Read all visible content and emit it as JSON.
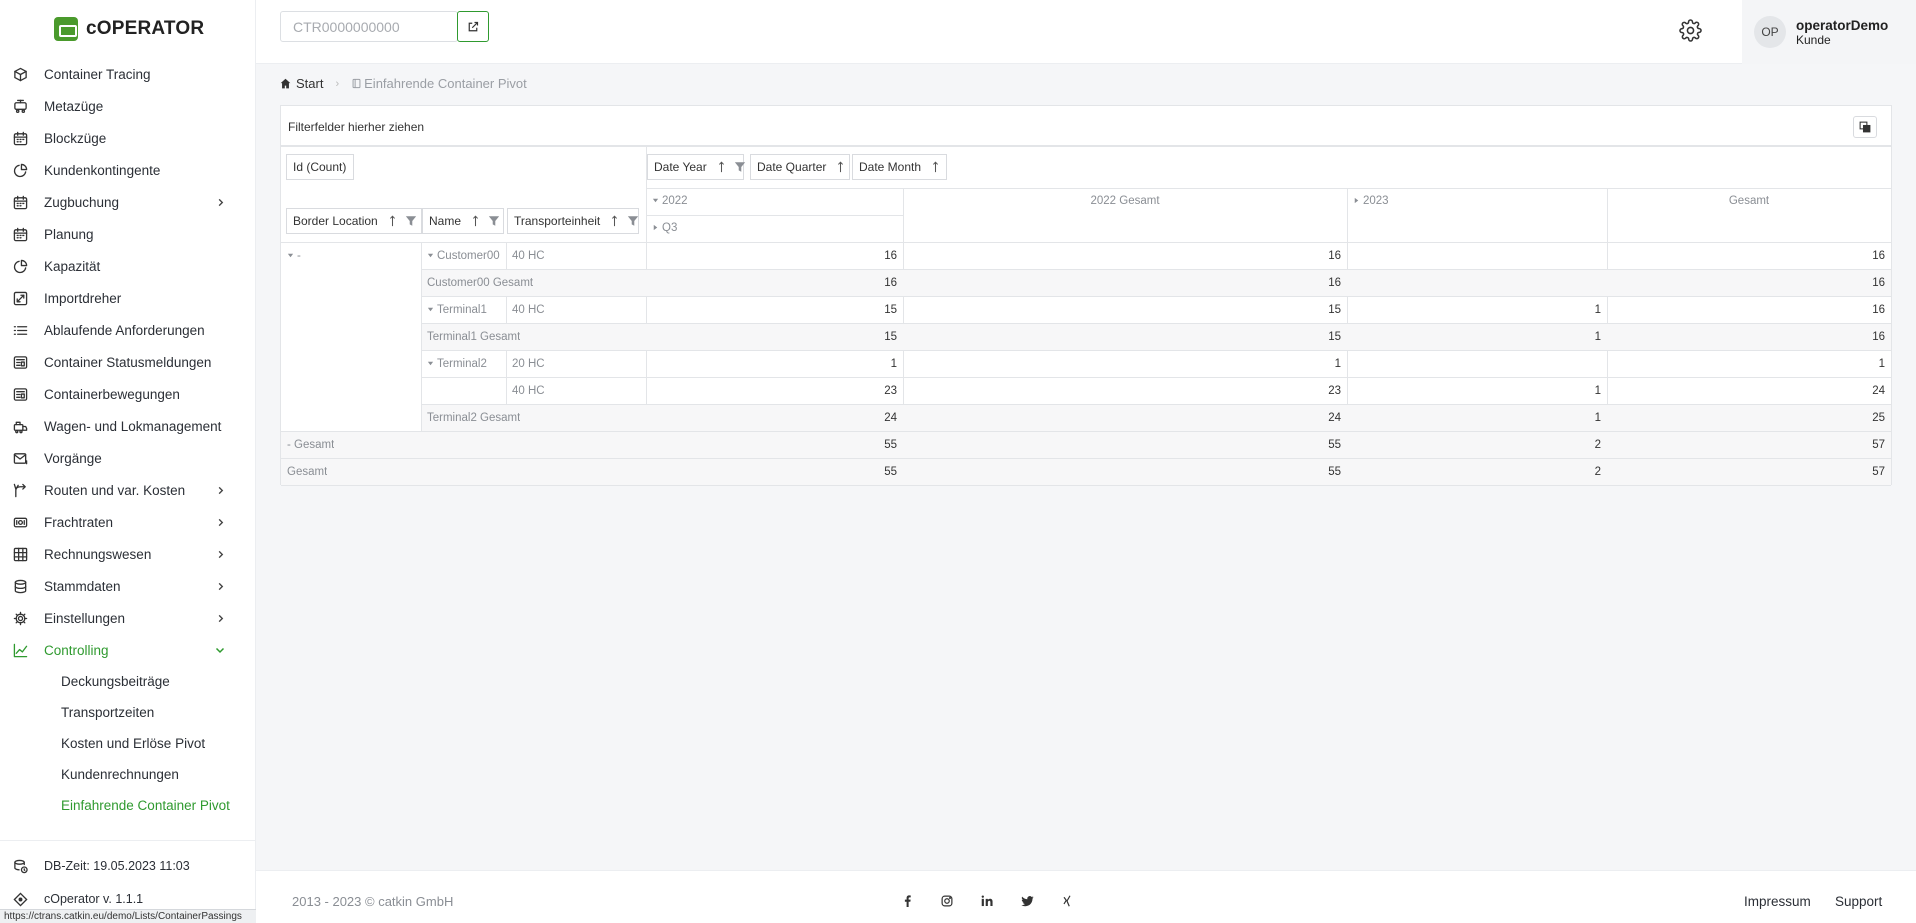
{
  "app": {
    "brand": "cOPERATOR"
  },
  "sidebar": {
    "items": [
      {
        "label": "Container Tracing",
        "icon": "cube-icon"
      },
      {
        "label": "Metazüge",
        "icon": "train-icon"
      },
      {
        "label": "Blockzüge",
        "icon": "calendar-icon"
      },
      {
        "label": "Kundenkontingente",
        "icon": "pie-icon"
      },
      {
        "label": "Zugbuchung",
        "icon": "calendar-icon",
        "expandable": true
      },
      {
        "label": "Planung",
        "icon": "calendar-icon"
      },
      {
        "label": "Kapazität",
        "icon": "pie-icon"
      },
      {
        "label": "Importdreher",
        "icon": "swap-icon"
      },
      {
        "label": "Ablaufende Anforderungen",
        "icon": "list-icon"
      },
      {
        "label": "Container Statusmeldungen",
        "icon": "news-icon"
      },
      {
        "label": "Containerbewegungen",
        "icon": "news-icon"
      },
      {
        "label": "Wagen- und Lokmanagement",
        "icon": "locomotive-icon"
      },
      {
        "label": "Vorgänge",
        "icon": "mail-icon"
      },
      {
        "label": "Routen und var. Kosten",
        "icon": "route-icon",
        "expandable": true
      },
      {
        "label": "Frachtraten",
        "icon": "money-icon",
        "expandable": true
      },
      {
        "label": "Rechnungswesen",
        "icon": "grid-icon",
        "expandable": true
      },
      {
        "label": "Stammdaten",
        "icon": "database-icon",
        "expandable": true
      },
      {
        "label": "Einstellungen",
        "icon": "gear-icon",
        "expandable": true
      },
      {
        "label": "Controlling",
        "icon": "chart-icon",
        "expandable": true,
        "active": true
      }
    ],
    "subitems": [
      "Deckungsbeiträge",
      "Transportzeiten",
      "Kosten und Erlöse Pivot",
      "Kundenrechnungen",
      "Einfahrende Container Pivot"
    ],
    "db_time": "DB-Zeit: 19.05.2023 11:03",
    "version": "cOperator v. 1.1.1",
    "status_url": "https://ctrans.catkin.eu/demo/Lists/ContainerPassings"
  },
  "topbar": {
    "search_placeholder": "CTR0000000000",
    "user_initials": "OP",
    "user_name": "operatorDemo",
    "user_role": "Kunde"
  },
  "breadcrumb": {
    "home": "Start",
    "current": "Einfahrende Container Pivot"
  },
  "pivot": {
    "filter_hint": "Filterfelder hierher ziehen",
    "data_field": "Id (Count)",
    "column_fields": [
      "Date Year",
      "Date Quarter",
      "Date Month"
    ],
    "row_fields": [
      "Border Location",
      "Name",
      "Transporteinheit"
    ],
    "col_headers": {
      "y2022": "2022",
      "q3": "Q3",
      "y2022_total": "2022 Gesamt",
      "y2023": "2023",
      "grand": "Gesamt"
    },
    "rows": [
      {
        "loc": "-",
        "name": "Customer00",
        "unit": "40 HC",
        "v": [
          "16",
          "16",
          "",
          "16"
        ]
      },
      {
        "label": "Customer00 Gesamt",
        "v": [
          "16",
          "16",
          "",
          "16"
        ]
      },
      {
        "name": "Terminal1",
        "unit": "40 HC",
        "v": [
          "15",
          "15",
          "1",
          "16"
        ]
      },
      {
        "label": "Terminal1 Gesamt",
        "v": [
          "15",
          "15",
          "1",
          "16"
        ]
      },
      {
        "name": "Terminal2",
        "unit": "20 HC",
        "v": [
          "1",
          "1",
          "",
          "1"
        ]
      },
      {
        "unit": "40 HC",
        "v": [
          "23",
          "23",
          "1",
          "24"
        ]
      },
      {
        "label": "Terminal2 Gesamt",
        "v": [
          "24",
          "24",
          "1",
          "25"
        ]
      },
      {
        "label": "- Gesamt",
        "v": [
          "55",
          "55",
          "2",
          "57"
        ]
      },
      {
        "label": "Gesamt",
        "v": [
          "55",
          "55",
          "2",
          "57"
        ]
      }
    ]
  },
  "footer": {
    "copyright": "2013 - 2023 © catkin GmbH",
    "impressum": "Impressum",
    "support": "Support"
  }
}
